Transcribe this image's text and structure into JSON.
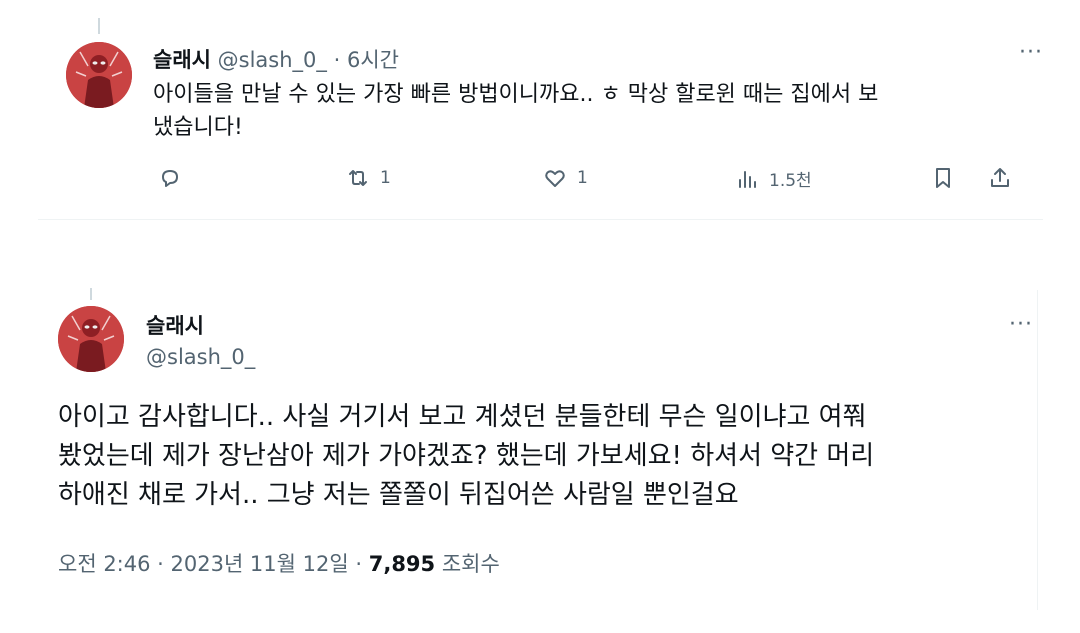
{
  "reply_tweet": {
    "display_name": "슬래시",
    "handle": "@slash_0_",
    "separator": "·",
    "time_ago": "6시간",
    "more": "···",
    "text_line1": "아이들을 만날 수 있는 가장 빠른 방법이니까요.. ㅎ 막상 할로윈 때는 집에서 보",
    "text_line2": "냈습니다!",
    "actions": {
      "reply_count": "",
      "retweet_count": "1",
      "like_count": "1",
      "views_count": "1.5천"
    }
  },
  "main_tweet": {
    "display_name": "슬래시",
    "handle": "@slash_0_",
    "more": "···",
    "text_line1": "아이고 감사합니다.. 사실 거기서 보고 계셨던 분들한테 무슨 일이냐고 여쭤",
    "text_line2": "봤었는데 제가 장난삼아 제가 가야겠죠? 했는데 가보세요! 하셔서 약간 머리",
    "text_line3": "하애진 채로 가서.. 그냥 저는 쫄쫄이 뒤집어쓴 사람일 뿐인걸요",
    "timestamp": "오전 2:46 · 2023년 11월 12일 · ",
    "views_number": "7,895",
    "views_label": " 조회수"
  },
  "icons": [
    "reply-icon",
    "retweet-icon",
    "like-icon",
    "views-icon",
    "bookmark-icon",
    "share-icon"
  ],
  "colors": {
    "muted": "#536471",
    "text": "#0f1419",
    "divider": "#eff3f4",
    "avatar_bg": "#c94343"
  }
}
